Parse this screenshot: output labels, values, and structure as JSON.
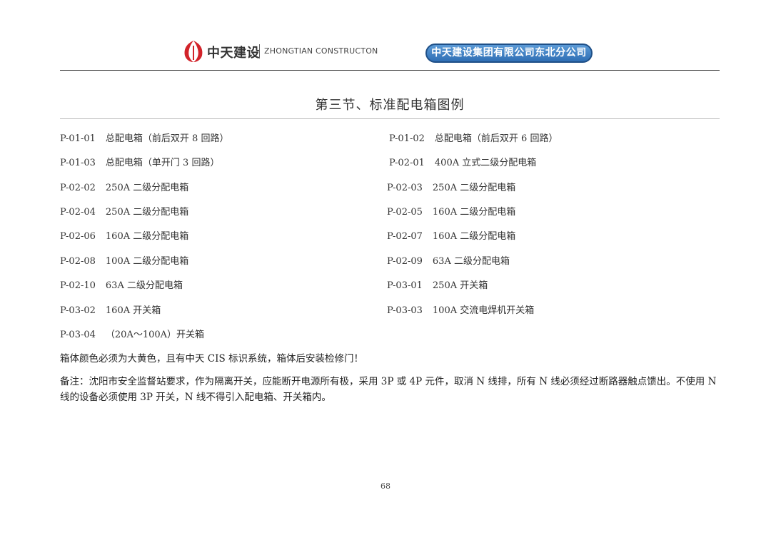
{
  "header": {
    "brand_cn": "中天建设",
    "brand_en": "ZHONGTIAN CONSTRUCTON",
    "company": "中天建设集团有限公司东北分公司"
  },
  "section_title": "第三节、标准配电箱图例",
  "items": [
    {
      "code": "P-01-01",
      "desc": "总配电箱（前后双开 8 回路）"
    },
    {
      "code": "P-01-02",
      "desc": "总配电箱（前后双开 6 回路）"
    },
    {
      "code": "P-01-03",
      "desc": "总配电箱（单开门 3 回路）"
    },
    {
      "code": "P-02-01",
      "desc": "400A 立式二级分配电箱"
    },
    {
      "code": "P-02-02",
      "desc": "250A 二级分配电箱"
    },
    {
      "code": "P-02-03",
      "desc": "250A 二级分配电箱"
    },
    {
      "code": "P-02-04",
      "desc": "250A 二级分配电箱"
    },
    {
      "code": "P-02-05",
      "desc": "160A 二级分配电箱"
    },
    {
      "code": "P-02-06",
      "desc": "160A 二级分配电箱"
    },
    {
      "code": "P-02-07",
      "desc": "160A 二级分配电箱"
    },
    {
      "code": "P-02-08",
      "desc": "100A 二级分配电箱"
    },
    {
      "code": "P-02-09",
      "desc": "63A 二级分配电箱"
    },
    {
      "code": "P-02-10",
      "desc": "63A 二级分配电箱"
    },
    {
      "code": "P-03-01",
      "desc": "250A 开关箱"
    },
    {
      "code": "P-03-02",
      "desc": "160A 开关箱"
    },
    {
      "code": "P-03-03",
      "desc": "100A 交流电焊机开关箱"
    },
    {
      "code": "P-03-04",
      "desc": "（20A～100A）开关箱"
    }
  ],
  "note": "箱体颜色必须为大黄色，且有中天 CIS 标识系统，箱体后安装检修门！",
  "remark": "备注：沈阳市安全监督站要求，作为隔离开关，应能断开电源所有极，采用 3P 或 4P 元件，取消 N 线排，所有 N 线必须经过断路器触点馈出。不使用 N 线的设备必须使用 3P 开关，N 线不得引入配电箱、开关箱内。",
  "page_number": "68",
  "colors": {
    "badge_fill": "#2f6fb5",
    "badge_border": "#1e4f87",
    "logo_red": "#d2232a"
  }
}
